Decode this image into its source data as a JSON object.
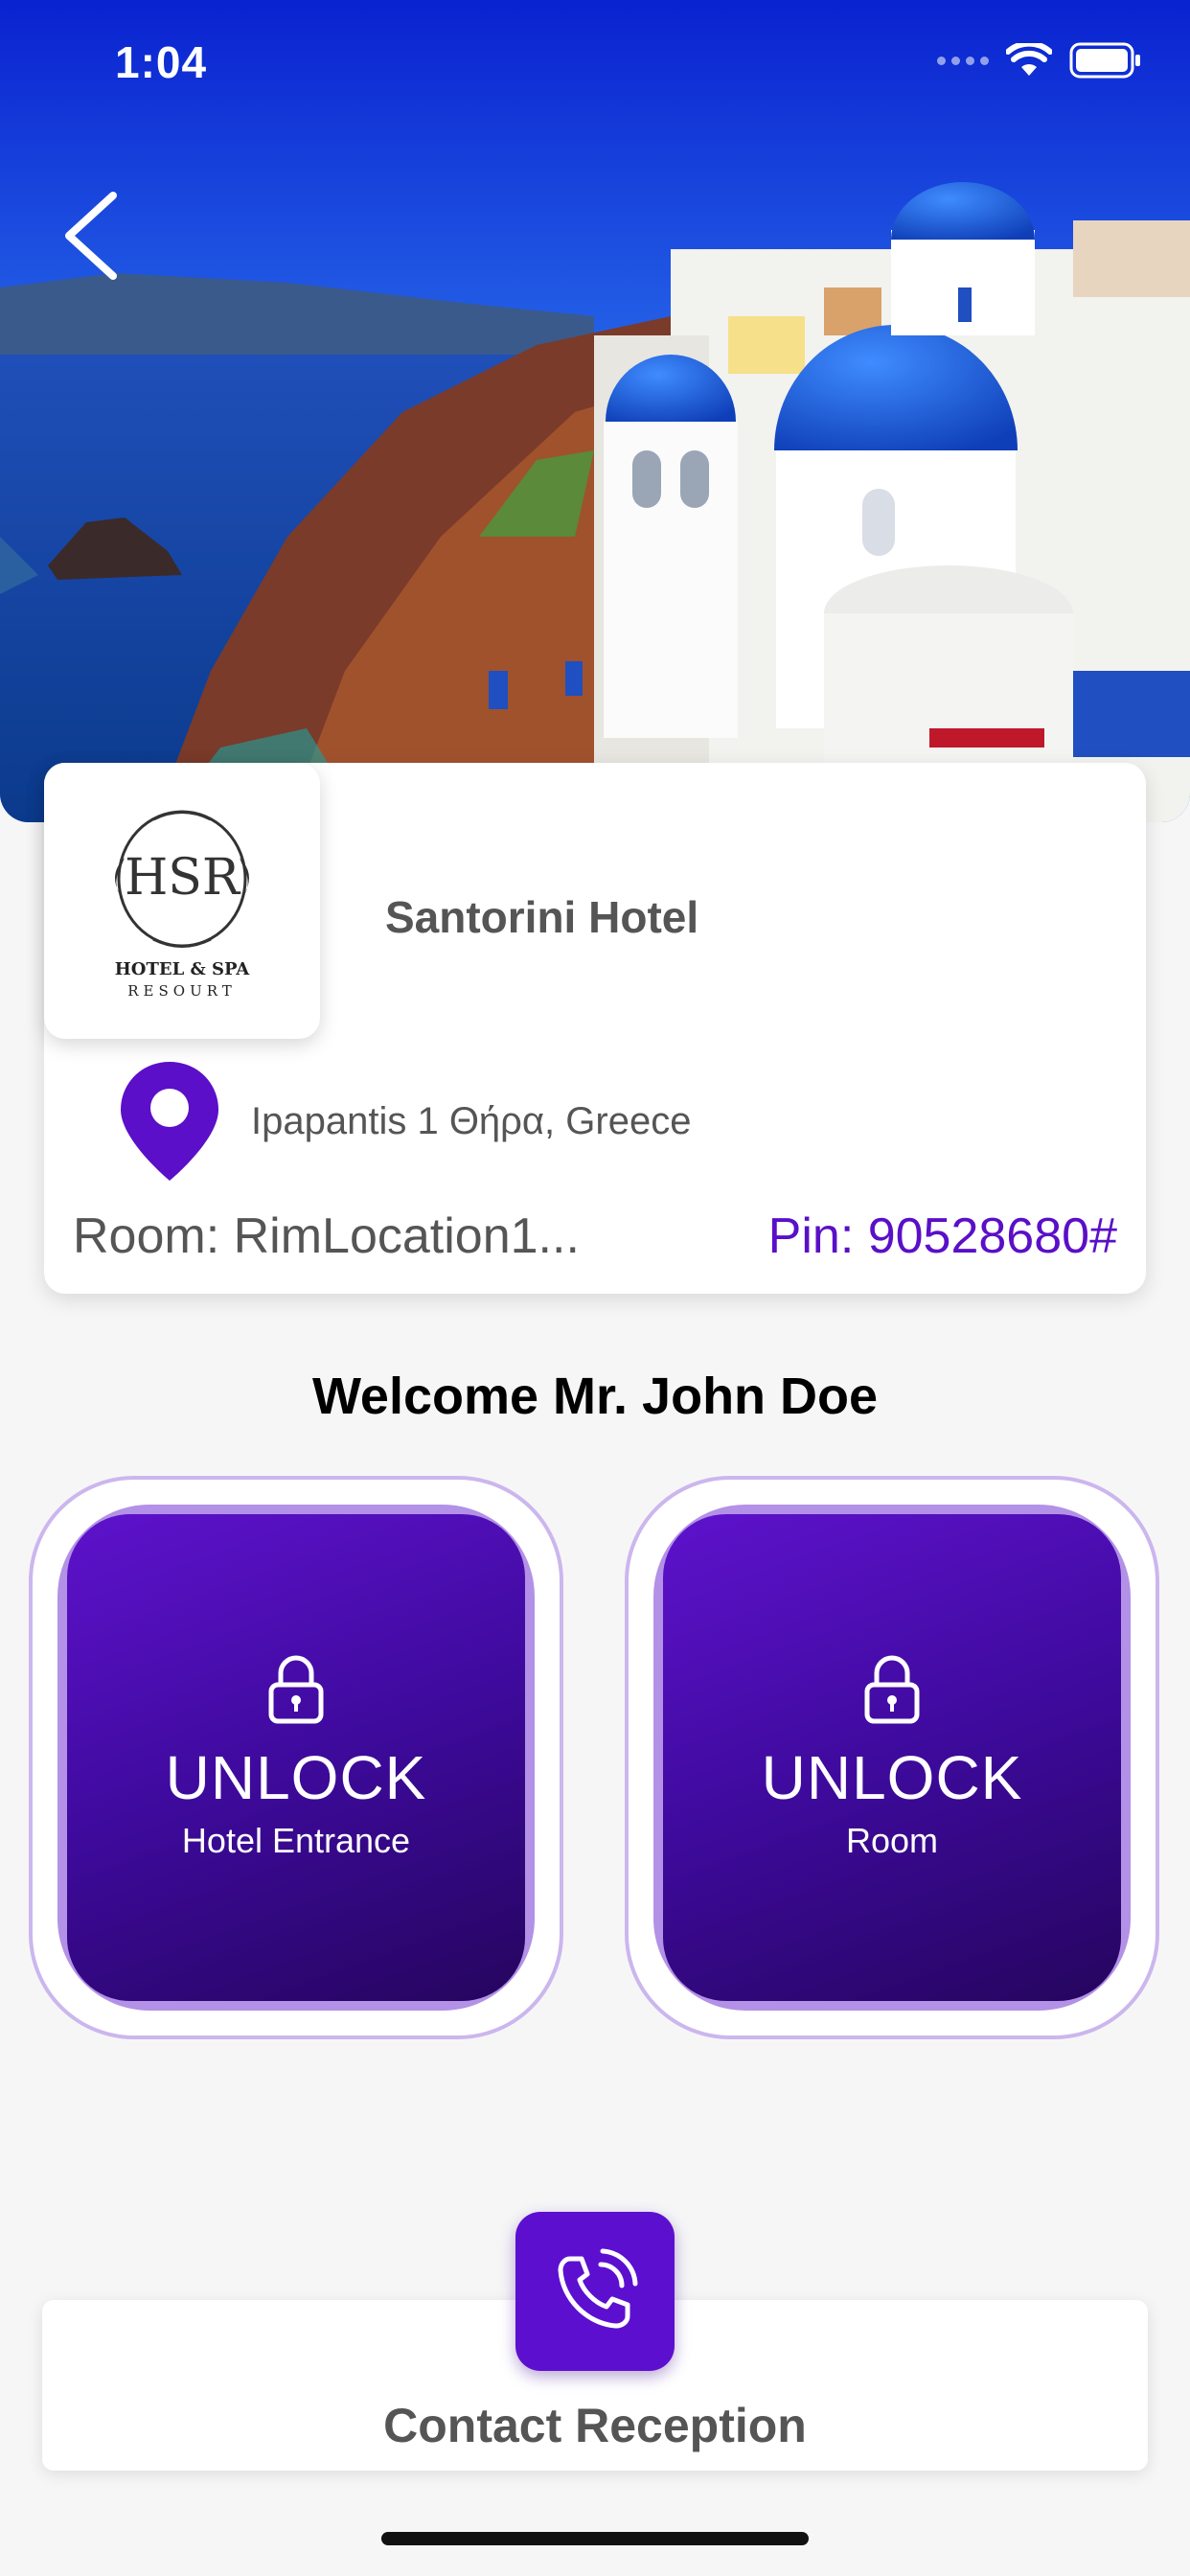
{
  "status_bar": {
    "time": "1:04"
  },
  "hotel": {
    "name": "Santorini Hotel",
    "address": "Ipapantis 1 Θήρα, Greece",
    "room": "Room: RimLocation1...",
    "pin": "Pin: 90528680#",
    "logo": {
      "monogram": "HSR",
      "line1": "HOTEL & SPA",
      "line2": "RESOURT"
    }
  },
  "welcome": "Welcome Mr. John Doe",
  "unlock_buttons": [
    {
      "title": "UNLOCK",
      "subtitle": "Hotel Entrance"
    },
    {
      "title": "UNLOCK",
      "subtitle": "Room"
    }
  ],
  "contact": {
    "label": "Contact Reception"
  },
  "colors": {
    "accent": "#5d0fd0",
    "pin_text": "#5a0fc8",
    "tile_ring": "#b391e6",
    "tile_border": "#ccb6ee"
  }
}
